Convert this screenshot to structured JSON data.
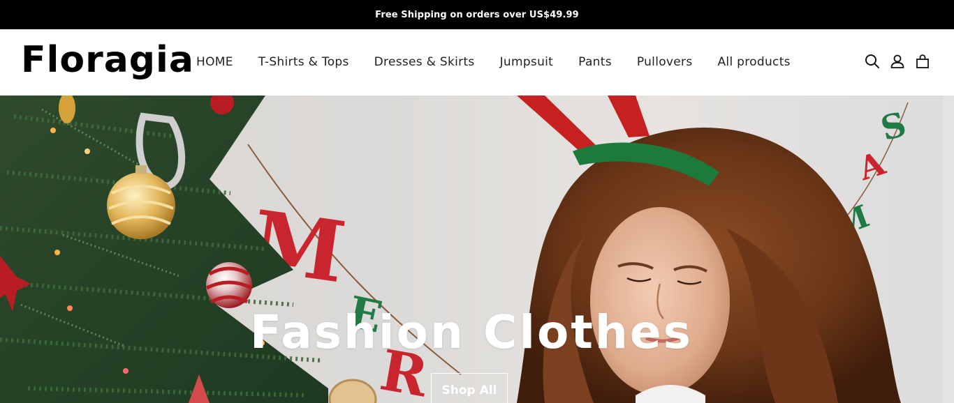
{
  "announcement": {
    "text": "Free Shipping on orders over US$49.99"
  },
  "brand": {
    "name": "Floragia"
  },
  "nav": {
    "items": [
      {
        "label": "HOME"
      },
      {
        "label": "T-Shirts & Tops"
      },
      {
        "label": "Dresses & Skirts"
      },
      {
        "label": "Jumpsuit"
      },
      {
        "label": "Pants"
      },
      {
        "label": "Pullovers"
      },
      {
        "label": "All products"
      }
    ]
  },
  "header_icons": [
    "search-icon",
    "account-icon",
    "cart-icon"
  ],
  "hero": {
    "title": "Fashion Clothes",
    "cta_label": "Shop All",
    "banner_letters": [
      "M",
      "E",
      "R",
      "M",
      "A",
      "S"
    ]
  },
  "colors": {
    "announcement_bg": "#000000",
    "header_bg": "#ffffff",
    "text": "#111111",
    "hero_text": "#ffffff"
  }
}
